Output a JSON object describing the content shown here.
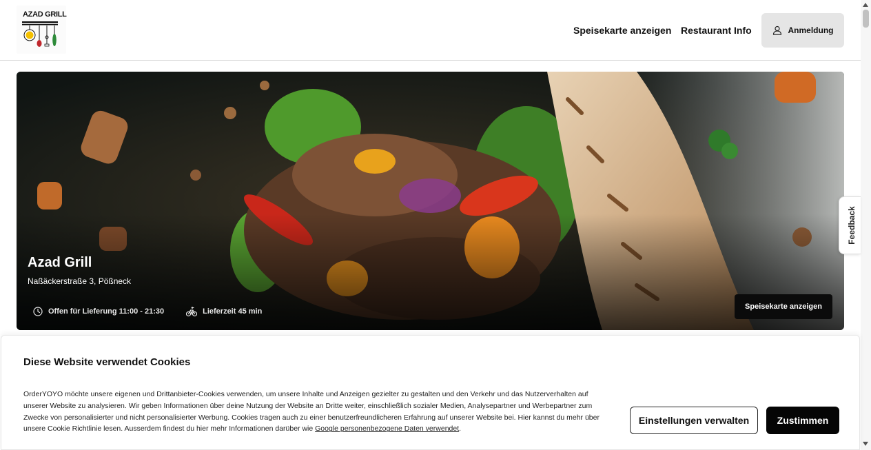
{
  "header": {
    "logo_text": "AZAD GRILL",
    "nav_menu": "Speisekarte anzeigen",
    "nav_info": "Restaurant Info",
    "login_label": "Anmeldung",
    "login_icon": "user-icon"
  },
  "hero": {
    "title": "Azad Grill",
    "address": "Naßäckerstraße 3, Pößneck",
    "opening_hours": "Offen für Lieferung 11:00 - 21:30",
    "opening_icon": "clock-icon",
    "delivery_time": "Lieferzeit 45 min",
    "delivery_icon": "bicycle-icon",
    "menu_button": "Speisekarte anzeigen"
  },
  "feedback": {
    "label": "Feedback"
  },
  "cookie_banner": {
    "title": "Diese Website verwendet Cookies",
    "text": "OrderYOYO möchte unsere eigenen und Drittanbieter-Cookies verwenden, um unsere Inhalte und Anzeigen gezielter zu gestalten und den Verkehr und das Nutzerverhalten auf unserer Website zu analysieren. Wir geben Informationen über deine Nutzung der Website an Dritte weiter, einschließlich sozialer Medien, Analysepartner und Werbepartner zum Zwecke von personalisierter und nicht personalisierter Werbung. Cookies tragen auch zu einer benutzerfreundlicheren Erfahrung auf unserer Website bei. Hier kannst du mehr über unsere Cookie Richtlinie lesen. Ausserdem findest du hier mehr Informationen darüber wie ",
    "link_text": "Google personenbezogene Daten verwendet",
    "text_end": ".",
    "settings_button": "Einstellungen verwalten",
    "accept_button": "Zustimmen"
  },
  "colors": {
    "accent_dark": "#050505",
    "button_gray": "#e5e5e5"
  }
}
